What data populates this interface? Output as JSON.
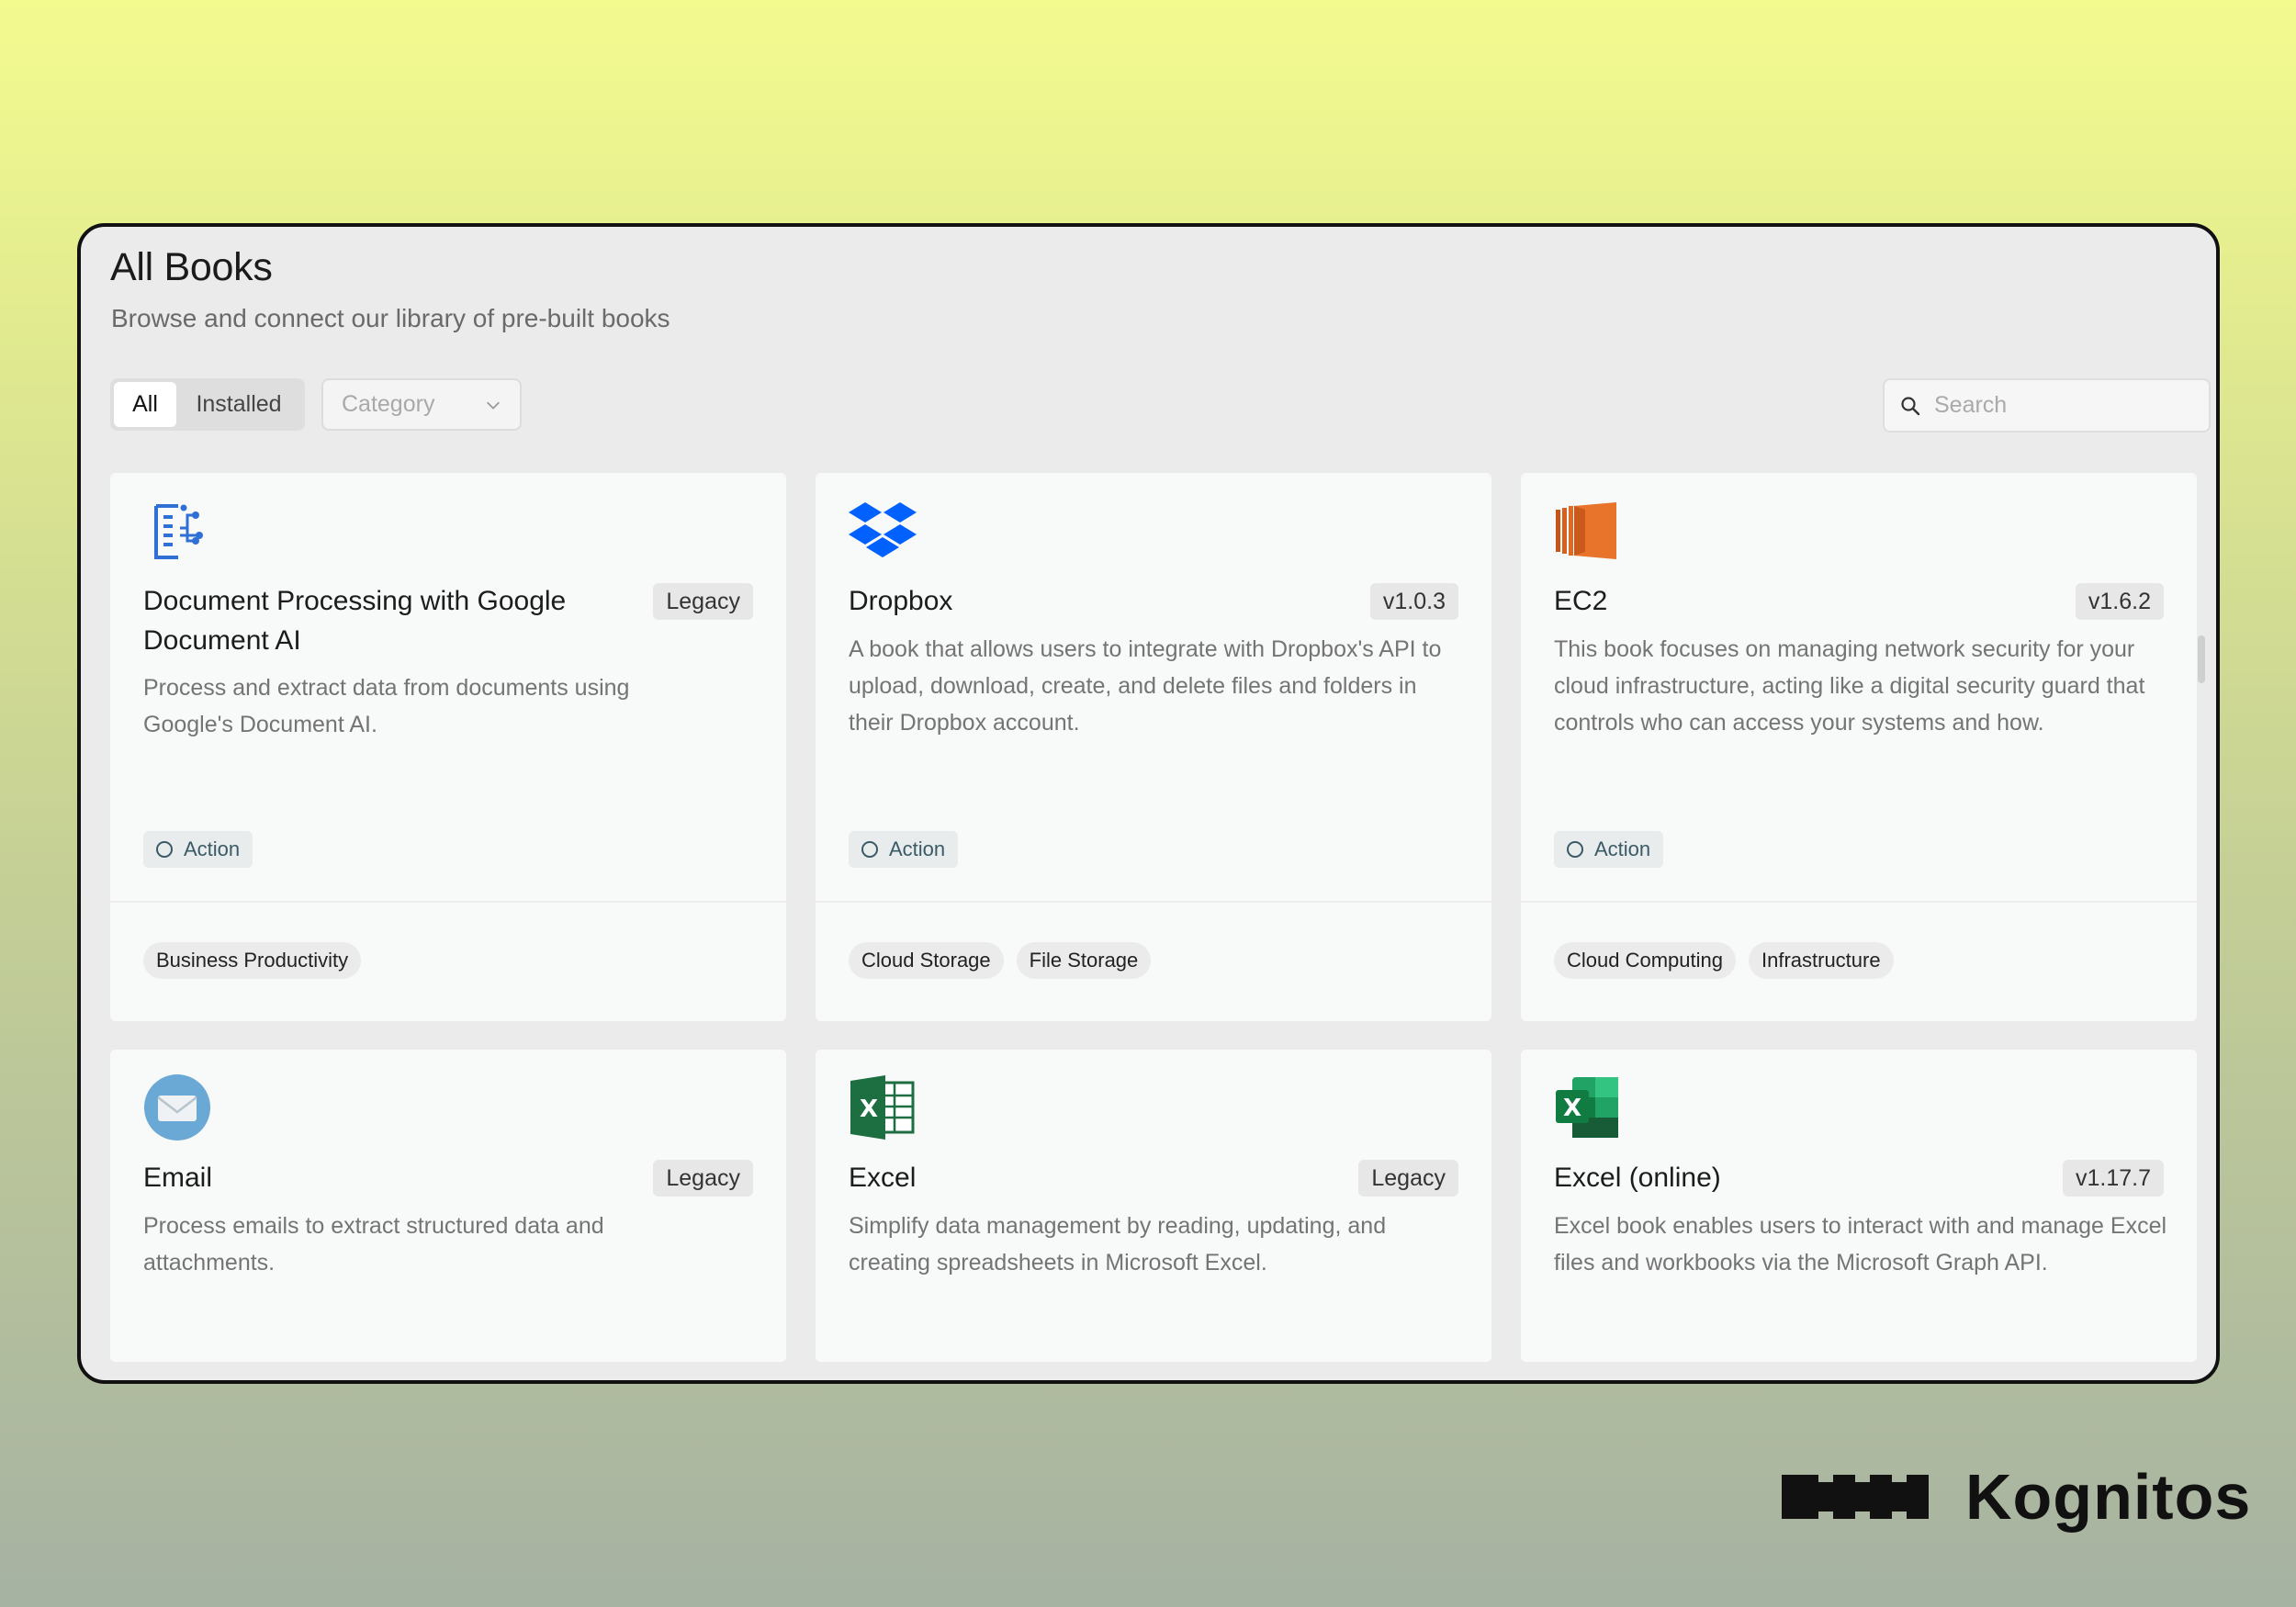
{
  "header": {
    "title": "All Books",
    "subtitle": "Browse and connect our library of pre-built books"
  },
  "filters": {
    "all_label": "All",
    "installed_label": "Installed",
    "category_placeholder": "Category",
    "search_placeholder": "Search"
  },
  "cards": [
    {
      "title": "Document Processing with Google Document AI",
      "badge": "Legacy",
      "description": "Process and extract data from documents using Google's Document AI.",
      "action": "Action",
      "tags": [
        "Business Productivity"
      ],
      "icon": "document-ai-icon"
    },
    {
      "title": "Dropbox",
      "badge": "v1.0.3",
      "description": "A book that allows users to integrate with Dropbox's API to upload, download, create, and delete files and folders in their Dropbox account.",
      "action": "Action",
      "tags": [
        "Cloud Storage",
        "File Storage"
      ],
      "icon": "dropbox-icon"
    },
    {
      "title": "EC2",
      "badge": "v1.6.2",
      "description": "This book focuses on managing network security for your cloud infrastructure, acting like a digital security guard that controls who can access your systems and how.",
      "action": "Action",
      "tags": [
        "Cloud Computing",
        "Infrastructure"
      ],
      "icon": "ec2-icon"
    },
    {
      "title": "Email",
      "badge": "Legacy",
      "description": "Process emails to extract structured data and attachments.",
      "icon": "email-icon"
    },
    {
      "title": "Excel",
      "badge": "Legacy",
      "description": "Simplify data management by reading, updating, and creating spreadsheets in Microsoft Excel.",
      "icon": "excel-icon"
    },
    {
      "title": "Excel (online)",
      "badge": "v1.17.7",
      "description": "Excel book enables users to interact with and manage Excel files and workbooks via the Microsoft Graph API.",
      "icon": "excel-online-icon"
    }
  ],
  "brand": {
    "name": "Kognitos"
  },
  "colors": {
    "dropbox": "#0061fe",
    "ec2": "#e8732a",
    "excel": "#1d6f42",
    "doc_ai": "#2f6fd6"
  }
}
